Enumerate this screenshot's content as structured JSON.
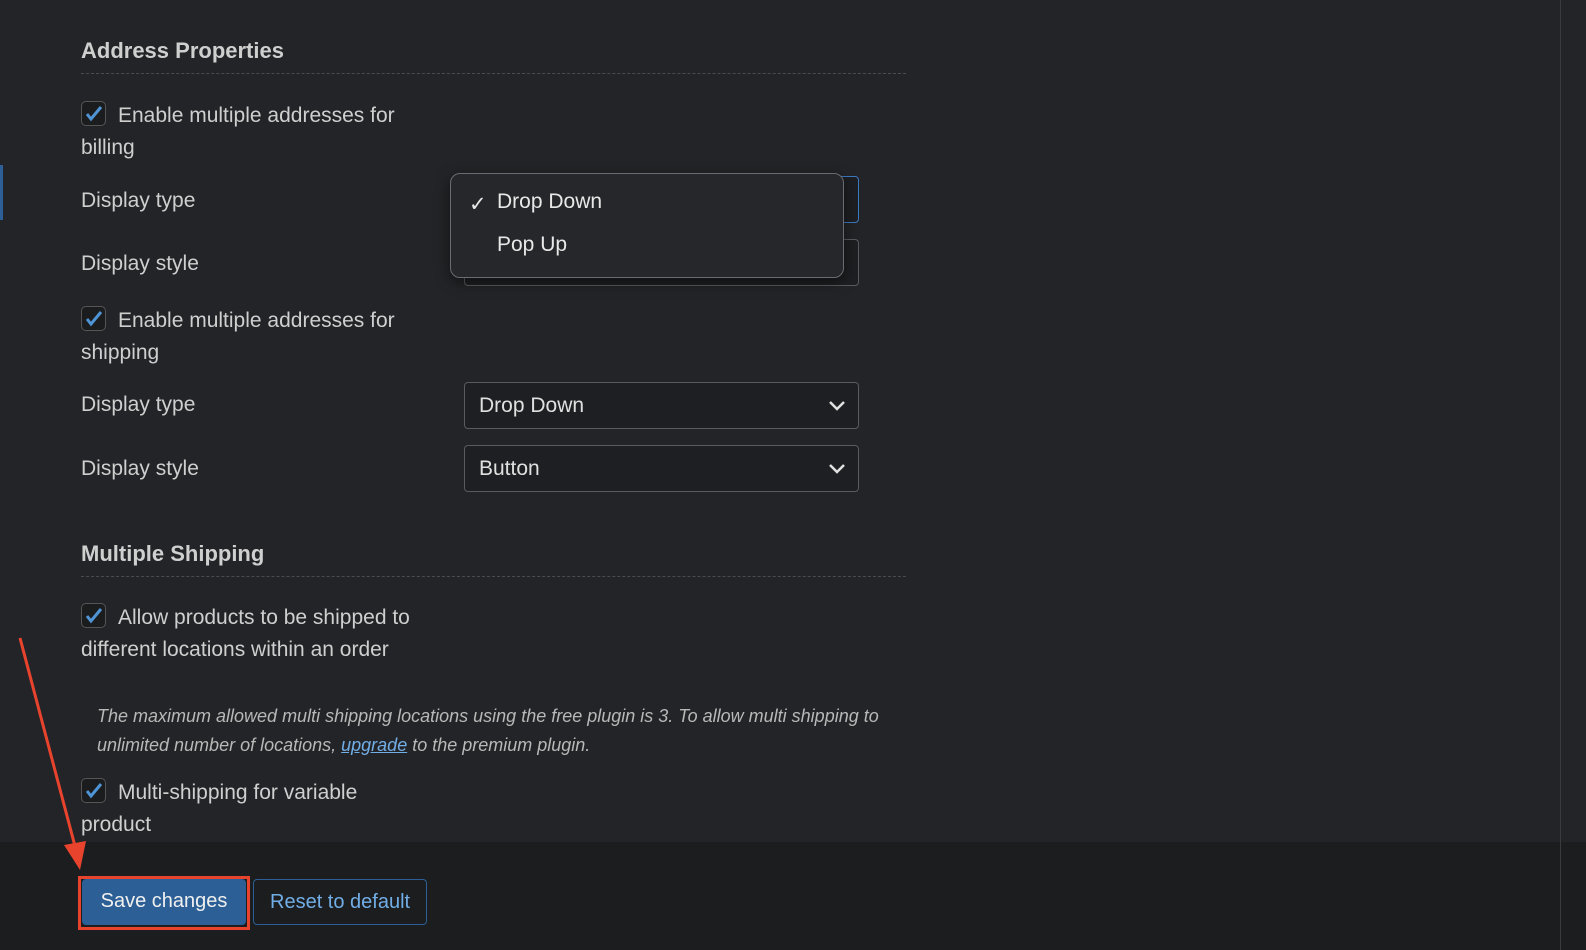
{
  "address": {
    "heading": "Address Properties",
    "billing": {
      "label": "Enable multiple addresses for billing",
      "checked": true,
      "display_type_label": "Display type",
      "display_type": "Drop Down",
      "display_style_label": "Display style"
    },
    "dropdown": {
      "options": [
        "Drop Down",
        "Pop Up"
      ],
      "selected": "Drop Down"
    },
    "shipping": {
      "label": "Enable multiple addresses for shipping",
      "checked": true,
      "display_type_label": "Display type",
      "display_type": "Drop Down",
      "display_style_label": "Display style",
      "display_style": "Button"
    }
  },
  "multi": {
    "heading": "Multiple Shipping",
    "allow": {
      "label": "Allow products to be shipped to different locations within an order",
      "checked": true
    },
    "desc_before": "The maximum allowed multi shipping locations using the free plugin is 3. To allow multi shipping to unlimited number of locations,",
    "desc_link": "upgrade",
    "desc_after": " to the premium plugin.",
    "variable": {
      "label": "Multi-shipping for variable product",
      "checked": true
    }
  },
  "footer": {
    "save": "Save changes",
    "reset": "Reset to default"
  },
  "colors": {
    "accent": "#2c5f95",
    "link": "#72aee6",
    "annotation": "#e8432d"
  }
}
